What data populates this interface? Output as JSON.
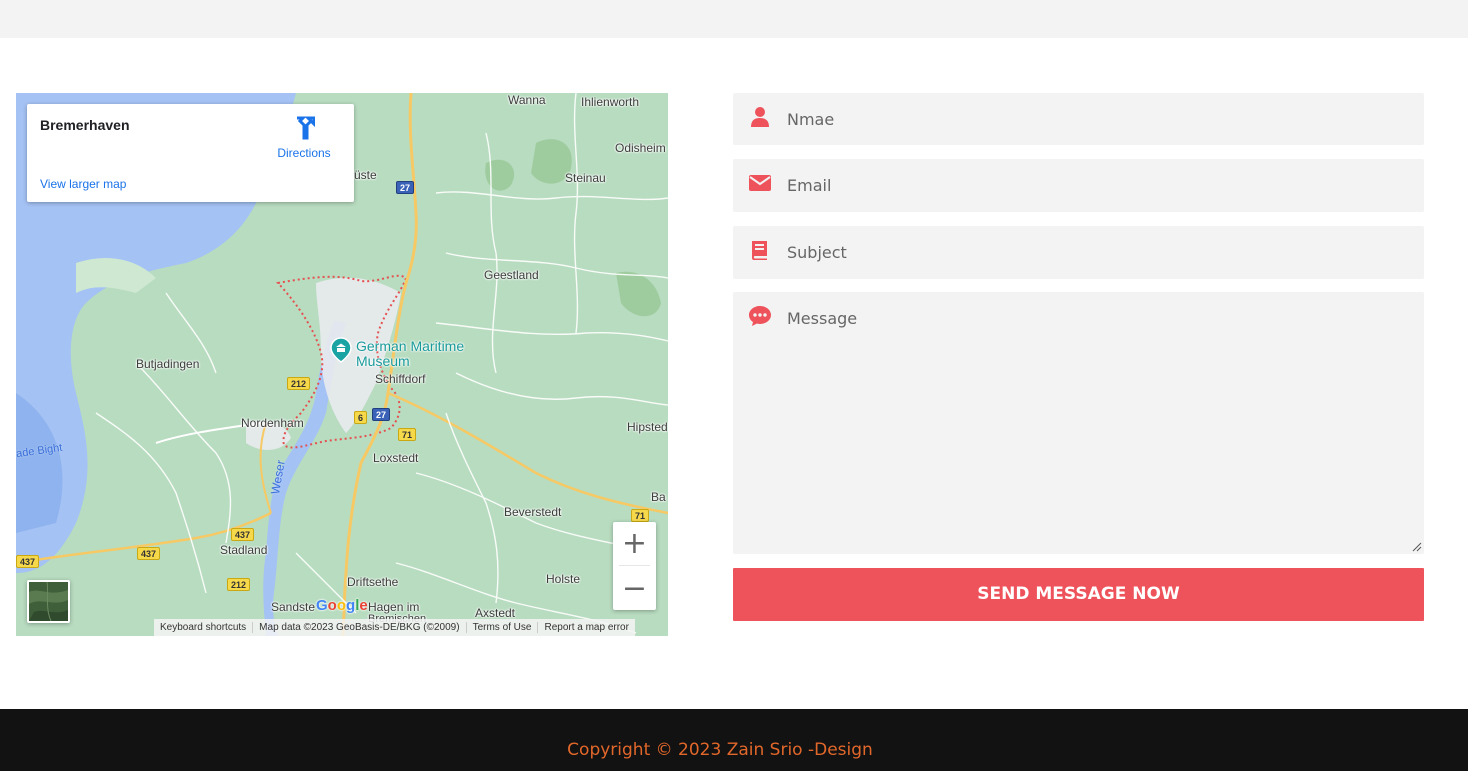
{
  "map": {
    "card": {
      "title": "Bremerhaven",
      "directions_label": "Directions",
      "larger_map_link": "View larger map"
    },
    "places": {
      "wanna": "Wanna",
      "ihlienworth": "Ihlienworth",
      "odisheim": "Odisheim",
      "steinau": "Steinau",
      "uste": "üste",
      "geestland": "Geestland",
      "butjadingen": "Butjadingen",
      "schiffdorf": "Schiffdorf",
      "nordenham": "Nordenham",
      "loxstedt": "Loxstedt",
      "hipstedt": "Hipsted",
      "beverstedt": "Beverstedt",
      "stadland": "Stadland",
      "driftsethe": "Driftsethe",
      "holste": "Holste",
      "axstedt": "Axstedt",
      "sandstedt": "Sandste",
      "hagen": "Hagen im",
      "bremischen": "Bremischen",
      "ba": "Ba"
    },
    "water": {
      "weser": "Weser",
      "jade_bight": "ade Bight"
    },
    "poi": {
      "line1": "German Maritime",
      "line2": "Museum"
    },
    "shields": {
      "a27_north": "27",
      "a27_south": "27",
      "b212_a": "212",
      "b212_b": "212",
      "b6": "6",
      "b71_a": "71",
      "b71_b": "71",
      "b437_a": "437",
      "b437_b": "437",
      "b437_c": "437"
    },
    "zoom_in": "+",
    "zoom_out": "−",
    "logo": "Google",
    "attribution": {
      "shortcuts": "Keyboard shortcuts",
      "data": "Map data ©2023 GeoBasis-DE/BKG (©2009)",
      "terms": "Terms of Use",
      "report": "Report a map error"
    }
  },
  "form": {
    "name_placeholder": "Nmae",
    "email_placeholder": "Email",
    "subject_placeholder": "Subject",
    "message_placeholder": "Message",
    "submit_label": "SEND MESSAGE NOW"
  },
  "footer": {
    "copyright": "Copyright © 2023 Zain Srio -Design"
  },
  "colors": {
    "accent": "#ee525b",
    "footer_bg": "#121212",
    "footer_text": "#e2672a",
    "field_bg": "#f3f3f3",
    "link_blue": "#1a73e8"
  }
}
